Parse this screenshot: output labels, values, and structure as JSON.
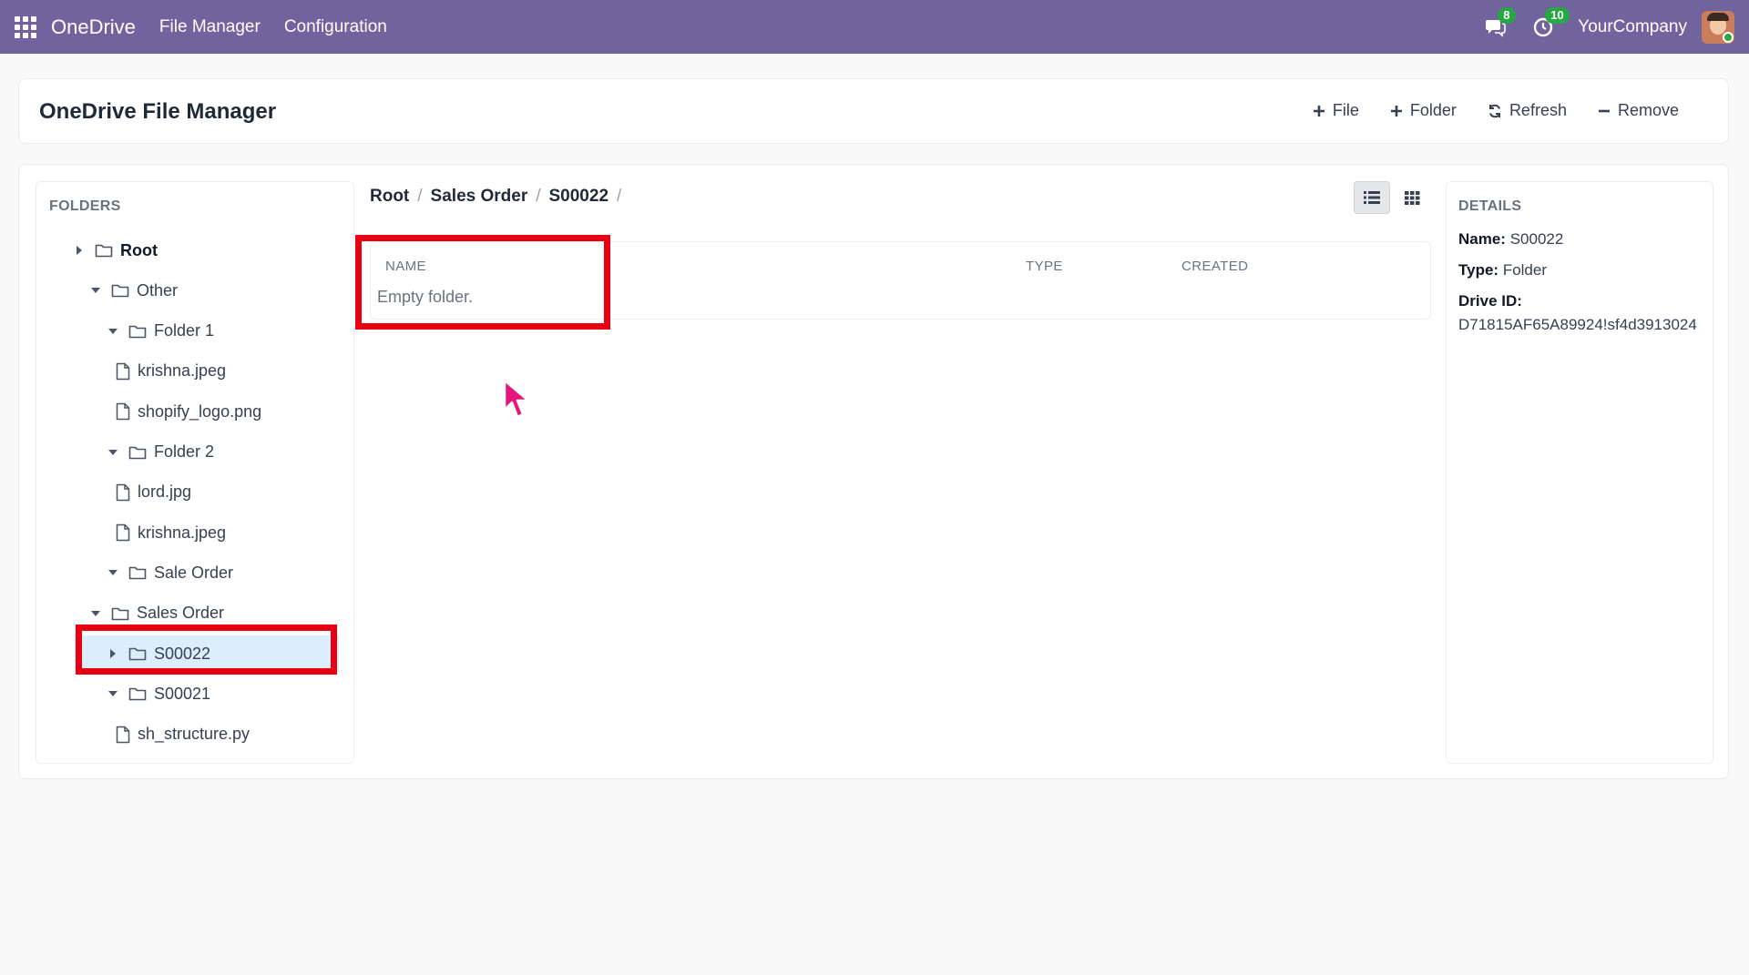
{
  "navbar": {
    "brand": "OneDrive",
    "menu": [
      "File Manager",
      "Configuration"
    ],
    "messages_badge": "8",
    "activities_badge": "10",
    "company": "YourCompany"
  },
  "control_panel": {
    "title": "OneDrive File Manager",
    "actions": {
      "file": "File",
      "folder": "Folder",
      "refresh": "Refresh",
      "remove": "Remove"
    }
  },
  "folders": {
    "heading": "FOLDERS",
    "tree": [
      {
        "label": "Root",
        "type": "folder",
        "level": 0,
        "caret": "right",
        "bold": true
      },
      {
        "label": "Other",
        "type": "folder",
        "level": 1,
        "caret": "down"
      },
      {
        "label": "Folder 1",
        "type": "folder",
        "level": 2,
        "caret": "down"
      },
      {
        "label": "krishna.jpeg",
        "type": "file",
        "level": 3
      },
      {
        "label": "shopify_logo.png",
        "type": "file",
        "level": 3
      },
      {
        "label": "Folder 2",
        "type": "folder",
        "level": 2,
        "caret": "down"
      },
      {
        "label": "lord.jpg",
        "type": "file",
        "level": 3
      },
      {
        "label": "krishna.jpeg",
        "type": "file",
        "level": 3
      },
      {
        "label": "Sale Order",
        "type": "folder",
        "level": 2,
        "caret": "down"
      },
      {
        "label": "Sales Order",
        "type": "folder",
        "level": 1,
        "caret": "down"
      },
      {
        "label": "S00022",
        "type": "folder",
        "level": 2,
        "caret": "right",
        "selected": true
      },
      {
        "label": "S00021",
        "type": "folder",
        "level": 2,
        "caret": "down"
      },
      {
        "label": "sh_structure.py",
        "type": "file",
        "level": 3
      }
    ]
  },
  "breadcrumb": [
    "Root",
    "Sales Order",
    "S00022"
  ],
  "table": {
    "columns": [
      "NAME",
      "TYPE",
      "CREATED"
    ],
    "empty_message": "Empty folder."
  },
  "details": {
    "heading": "DETAILS",
    "name_label": "Name:",
    "name_value": "S00022",
    "type_label": "Type:",
    "type_value": "Folder",
    "drive_id_label": "Drive ID:",
    "drive_id_value": "D71815AF65A89924!sf4d3913024"
  },
  "colors": {
    "navbar": "#71639e",
    "highlight_outline": "#e60012",
    "selected_row": "#dceefb",
    "badge": "#28a745"
  }
}
